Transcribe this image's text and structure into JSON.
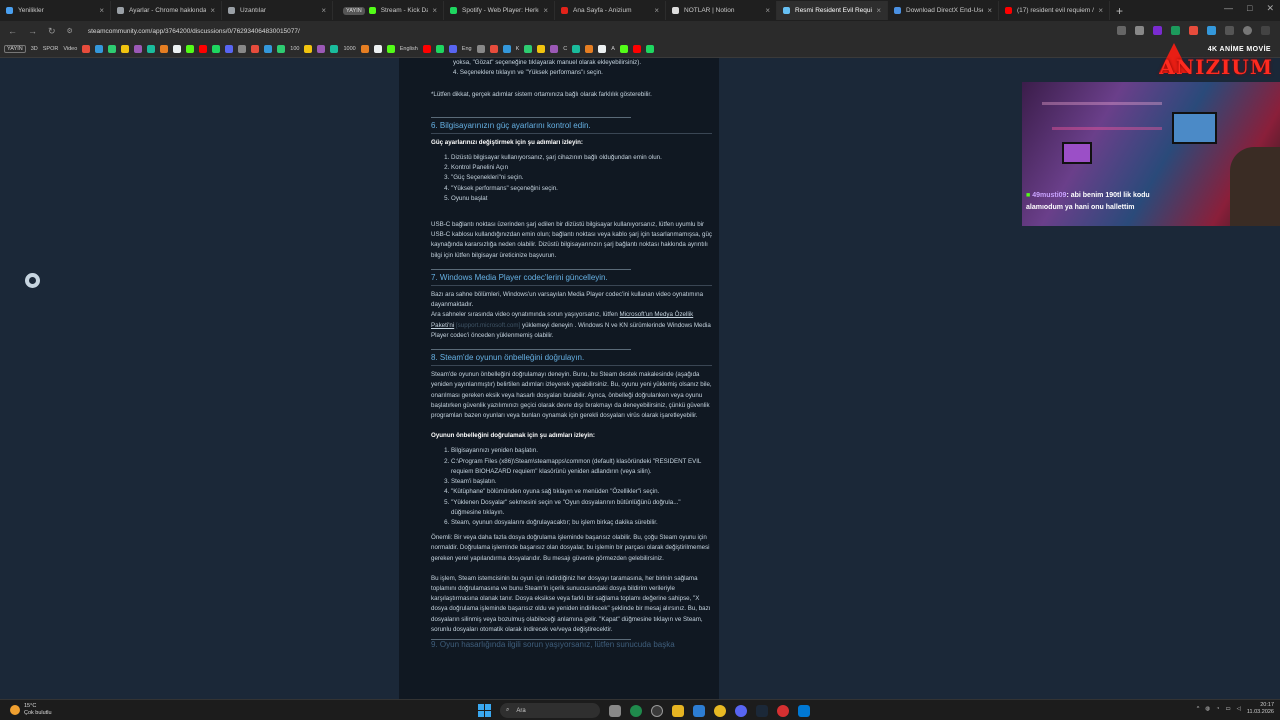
{
  "browser": {
    "tabs": [
      {
        "label": "Yenilikler",
        "color": "#4aa0f0",
        "active": false
      },
      {
        "label": "Ayarlar - Chrome hakkında",
        "color": "#9aa0a6",
        "active": false
      },
      {
        "label": "Uzantılar",
        "color": "#9aa0a6",
        "active": false
      },
      {
        "label": "Stream - Kick Dashboard",
        "color": "#53fc18",
        "active": false,
        "pill": "YAYIN"
      },
      {
        "label": "Spotify - Web Player: Herkes",
        "color": "#1ed760",
        "active": false
      },
      {
        "label": "Ana Sayfa - Anizium",
        "color": "#e2231a",
        "active": false
      },
      {
        "label": "NOTLAR | Notion",
        "color": "#dddddd",
        "active": false
      },
      {
        "label": "Resmi Resident Evil Requiem",
        "color": "#66c0f4",
        "active": true
      },
      {
        "label": "Download DirectX End-User",
        "color": "#4a90e2",
        "active": false
      },
      {
        "label": "(17) resident evil requiem / …",
        "color": "#ff0000",
        "active": false
      }
    ],
    "url": "steamcommunity.com/app/3764200/discussions/0/762934064830015077/",
    "bookmarks": [
      {
        "label": "YAYIN",
        "boxed": true
      },
      {
        "label": "3D",
        "boxed": false
      },
      {
        "label": "SPOR",
        "boxed": false
      },
      {
        "label": "Video",
        "boxed": false
      },
      {
        "label": "100",
        "boxed": false
      },
      {
        "label": "1000",
        "boxed": false
      },
      {
        "label": "English",
        "boxed": false
      },
      {
        "label": "Eng",
        "boxed": false
      },
      {
        "label": "K",
        "boxed": false
      },
      {
        "label": "C",
        "boxed": false
      },
      {
        "label": "A",
        "boxed": false
      }
    ]
  },
  "article": {
    "top_lines": [
      "yoksa, \"Gözat\" seçeneğine tıklayarak manuel olarak ekleyebilirsiniz).",
      "4. Seçeneklere tıklayın ve \"Yüksek performans\"ı seçin."
    ],
    "note": "*Lütfen dikkat, gerçek adımlar sistem ortamınıza bağlı olarak farklılık gösterebilir.",
    "sec6": {
      "title": "6. Bilgisayarınızın güç ayarlarını kontrol edin.",
      "intro": "Güç ayarlarınızı değiştirmek için şu adımları izleyin:",
      "steps": [
        "Dizüstü bilgisayar kullanıyorsanız, şarj cihazının bağlı olduğundan emin olun.",
        "Kontrol Panelini Açın",
        "\"Güç Seçenekleri\"ni seçin.",
        "\"Yüksek performans\" seçeneğini seçin.",
        "Oyunu başlat"
      ],
      "usb": "USB-C bağlantı noktası üzerinden şarj edilen bir dizüstü bilgisayar kullanıyorsanız, lütfen uyumlu bir USB-C kablosu kullandığınızdan emin olun; bağlantı noktası veya kablo şarj için tasarlanmamışsa, güç kaynağında kararsızlığa neden olabilir. Dizüstü bilgisayarınızın şarj bağlantı noktası hakkında ayrıntılı bilgi için lütfen bilgisayar üreticinize başvurun."
    },
    "sec7": {
      "title": "7. Windows Media Player codec'lerini güncelleyin.",
      "p1": "Bazı ara sahne bölümleri, Windows'un varsayılan Media Player codec'ini kullanan video oynatımına dayanmaktadır.",
      "p2_pre": "Ara sahneler sırasında video oynatımında sorun yaşıyorsanız, lütfen ",
      "link": "Microsoft'un Medya Özellik Paketi'ni",
      "link_host": "[support.microsoft.com]",
      "p2_post": " yüklemeyi deneyin . Windows N ve KN sürümlerinde Windows Media Player codec'i önceden yüklenmemiş olabilir."
    },
    "sec8": {
      "title": "8. Steam'de oyunun önbelleğini doğrulayın.",
      "p1": "Steam'de oyunun önbelleğini doğrulamayı deneyin. Bunu, bu Steam destek makalesinde (aşağıda yeniden yayınlanmıştır) belirtilen adımları izleyerek yapabilirsiniz. Bu, oyunu yeni yüklemiş olsanız bile, onarılması gereken eksik veya hasarlı dosyaları bulabilir. Ayrıca, önbelleği doğrulanken veya oyunu başlatırken güvenlik yazılımınızı geçici olarak devre dışı bırakmayı da deneyebilirsiniz, çünkü güvenlik programları bazen oyunları veya bunları oynamak için gerekli dosyaları virüs olarak işaretleyebilir.",
      "intro": "Oyunun önbelleğini doğrulamak için şu adımları izleyin:",
      "steps": [
        "Bilgisayarınızı yeniden başlatın.",
        "C:\\Program Files (x86)\\Steam\\steamapps\\common (default) klasöründeki \"RESIDENT EVIL requiem BIOHAZARD requiem\" klasörünü yeniden adlandırın (veya silin).",
        "Steam'i başlatın.",
        "\"Kütüphane\" bölümünden oyuna sağ tıklayın ve menüden \"Özellikler\"i seçin.",
        "\"Yüklenen Dosyalar\" sekmesini seçin ve \"Oyun dosyalarının bütünlüğünü doğrula...\" düğmesine tıklayın.",
        "Steam, oyunun dosyalarını doğrulayacaktır; bu işlem birkaç dakika sürebilir."
      ],
      "p2": "Önemli: Bir veya daha fazla dosya doğrulama işleminde başarısız olabilir. Bu, çoğu Steam oyunu için normaldir. Doğrulama işleminde başarısız olan dosyalar, bu işlemin bir parçası olarak değiştirilmemesi gereken yerel yapılandırma dosyalarıdır. Bu mesajı güvenle görmezden gelebilirsiniz.",
      "p3": "Bu işlem, Steam istemcisinin bu oyun için indirdiğiniz her dosyayı taramasına, her birinin sağlama toplamını doğrulamasına ve bunu Steam'in içerik sunucusundaki dosya bildirim verileriyle karşılaştırmasına olanak tanır. Dosya eksikse veya farklı bir sağlama toplamı değerine sahipse, \"X dosya doğrulama işleminde başarısız oldu ve yeniden indirilecek\" şeklinde bir mesaj alırsınız. Bu, bazı dosyaların silinmiş veya bozulmuş olabileceği anlamına gelir. \"Kapat\" düğmesine tıklayın ve Steam, sorunlu dosyaları otomatik olarak indirecek ve/veya değiştirecektir."
    },
    "sec9_partial": "9. Oyun hasarlığında ilgili sorun yaşıyorsanız, lütfen sunucuda başka"
  },
  "overlay": {
    "logo_small": "4K ANİME MOVİE",
    "logo_big": "ANIZIUM"
  },
  "chat": {
    "user": "49musti09",
    "message": ": abi benim 190tl lik kodu alamıodum ya hani onu hallettim"
  },
  "taskbar": {
    "temp": "15°C",
    "weather": "Çok bulutlu",
    "search": "Ara",
    "time": "20:17",
    "date": "11.03.2026"
  }
}
